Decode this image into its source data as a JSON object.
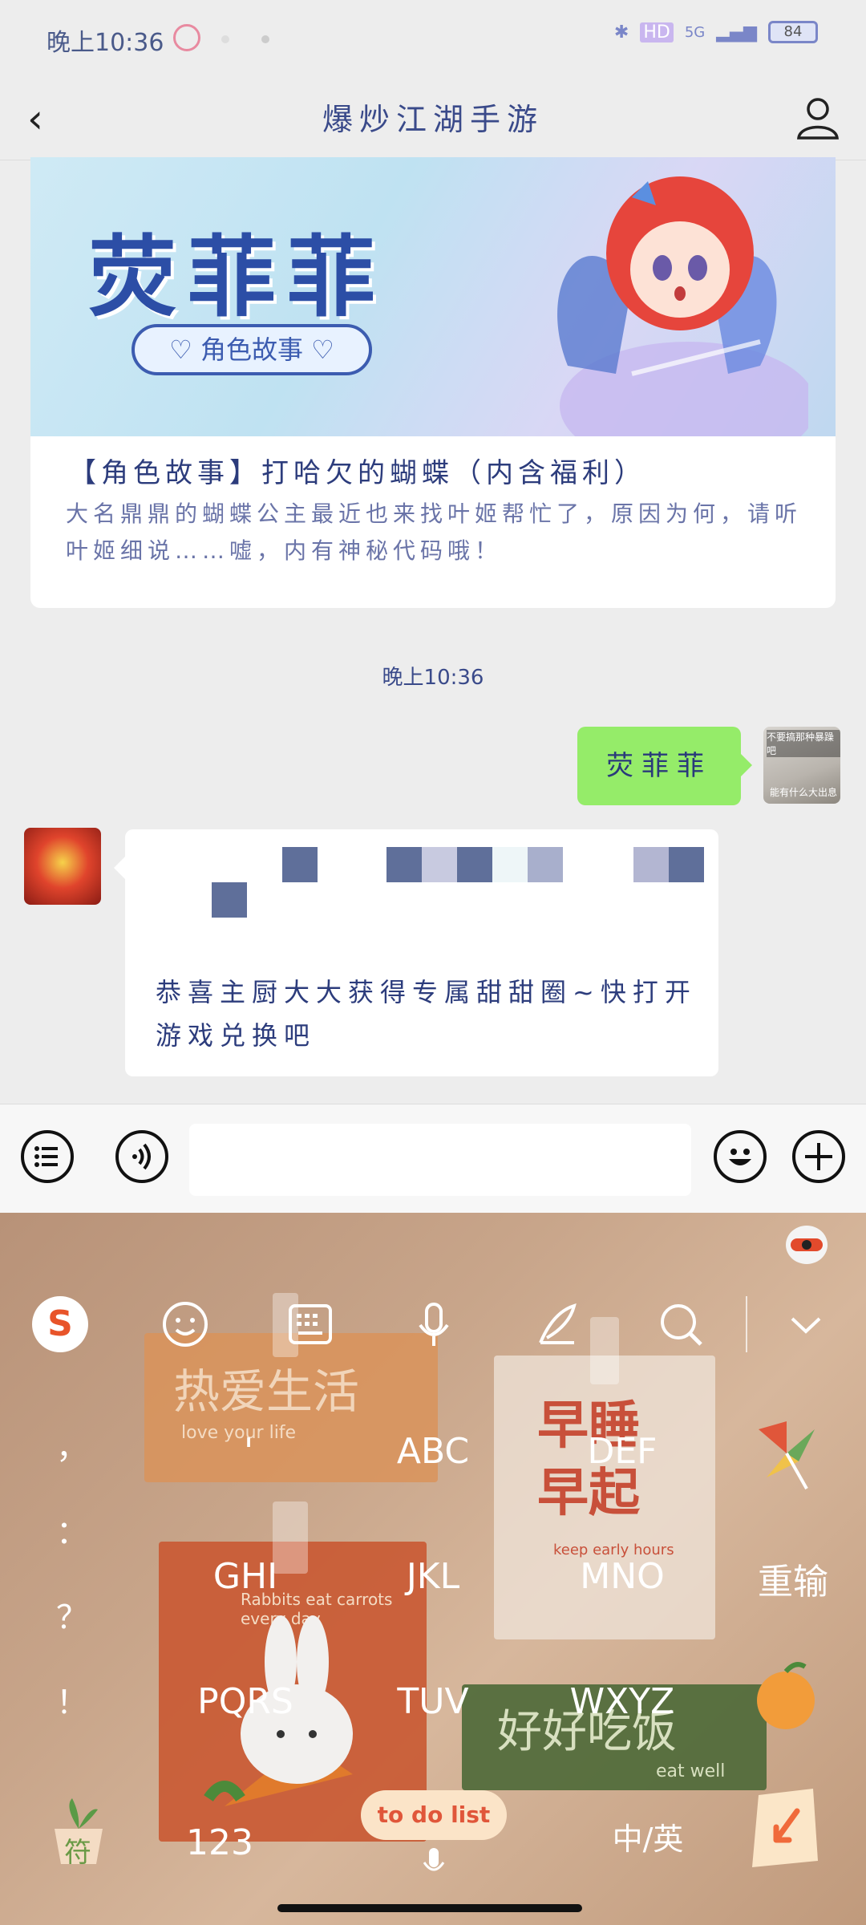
{
  "status_bar": {
    "time": "晚上10:36",
    "network": "5G",
    "battery": "84"
  },
  "nav": {
    "title": "爆炒江湖手游"
  },
  "article": {
    "banner_title": "荧菲菲",
    "banner_tag": "♡ 角色故事 ♡",
    "title": "【角色故事】打哈欠的蝴蝶（内含福利）",
    "description": "大名鼎鼎的蝴蝶公主最近也来找叶姬帮忙了，原因为何，请听叶姬细说……嘘，内有神秘代码哦！"
  },
  "timestamp": "晚上10:36",
  "outgoing_message": "荧菲菲",
  "my_avatar": {
    "caption_top": "不要搞那种暴躁吧",
    "caption_bottom": "能有什么大出息"
  },
  "incoming_message": "恭喜主厨大大获得专属甜甜圈~快打开游戏兑换吧",
  "input_bar": {
    "placeholder": ""
  },
  "keyboard": {
    "punctuation": [
      "，",
      "：",
      "？",
      "！"
    ],
    "keys": [
      "'",
      "ABC",
      "DEF",
      "GHI",
      "JKL",
      "MNO",
      "PQRS",
      "TUV",
      "WXYZ"
    ],
    "reenter": "重输",
    "symbols": "符",
    "numbers": "123",
    "space_label": "to do list",
    "lang_switch": "中/英",
    "deco_texts": [
      "热爱生活",
      "love your life",
      "早睡早起",
      "keep early hours",
      "Rabbits eat carrots every day",
      "好好吃饭",
      "eat well"
    ]
  },
  "colors": {
    "accent_green": "#95ec69",
    "title_blue": "#3a4a8a",
    "keyboard_bg": "#c8a58a"
  }
}
